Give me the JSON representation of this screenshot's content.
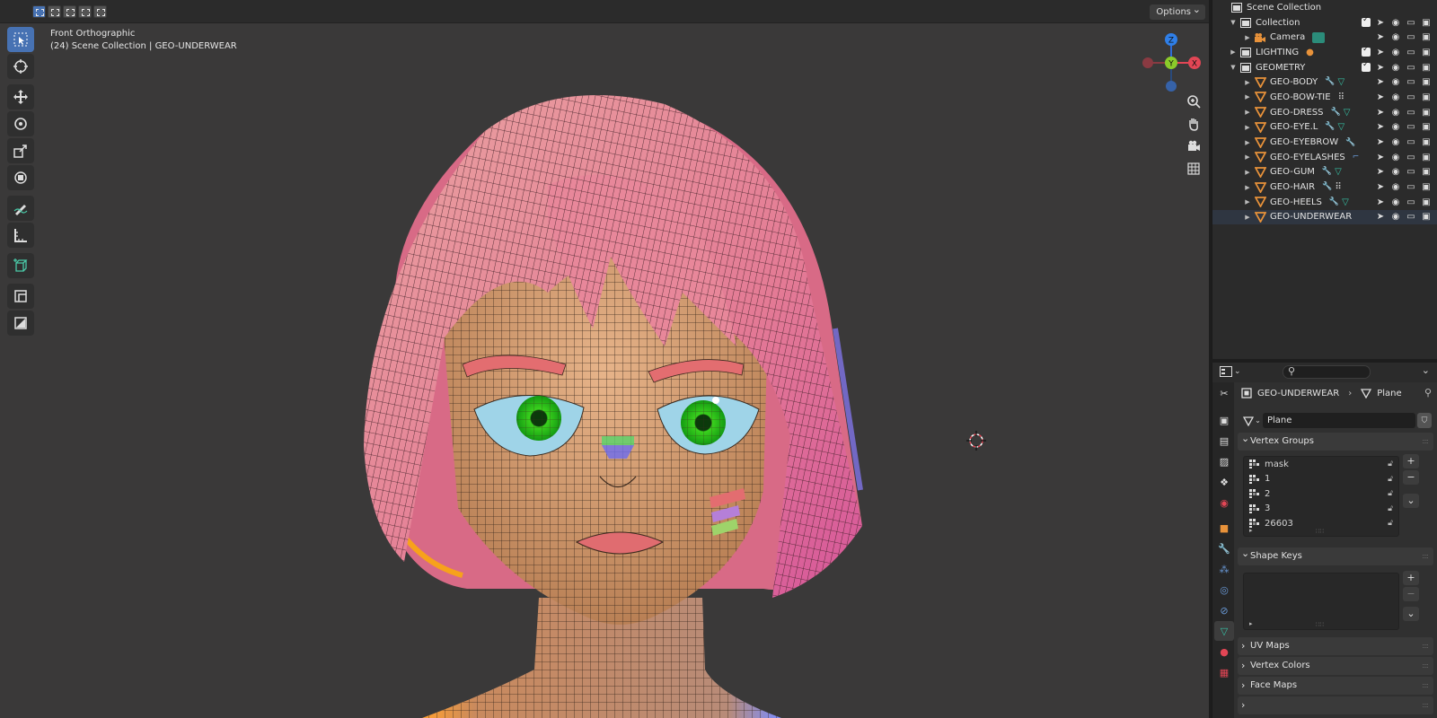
{
  "viewport": {
    "mode_label": "Front Orthographic",
    "context_label": "(24) Scene Collection | GEO-UNDERWEAR",
    "options_label": "Options",
    "gizmo": {
      "z": "Z",
      "y": "Y",
      "x": "X"
    }
  },
  "outliner": {
    "root": "Scene Collection",
    "rows": [
      {
        "name": "Collection",
        "depth": 1,
        "type": "collection",
        "checked": true
      },
      {
        "name": "Camera",
        "depth": 2,
        "type": "camera",
        "checked": false
      },
      {
        "name": "LIGHTING",
        "depth": 1,
        "type": "collection",
        "checked": true
      },
      {
        "name": "GEOMETRY",
        "depth": 1,
        "type": "collection",
        "checked": true
      },
      {
        "name": "GEO-BODY",
        "depth": 2,
        "type": "mesh"
      },
      {
        "name": "GEO-BOW-TIE",
        "depth": 2,
        "type": "mesh"
      },
      {
        "name": "GEO-DRESS",
        "depth": 2,
        "type": "mesh"
      },
      {
        "name": "GEO-EYE.L",
        "depth": 2,
        "type": "mesh"
      },
      {
        "name": "GEO-EYEBROW",
        "depth": 2,
        "type": "mesh"
      },
      {
        "name": "GEO-EYELASHES",
        "depth": 2,
        "type": "mesh"
      },
      {
        "name": "GEO-GUM",
        "depth": 2,
        "type": "mesh"
      },
      {
        "name": "GEO-HAIR",
        "depth": 2,
        "type": "mesh"
      },
      {
        "name": "GEO-HEELS",
        "depth": 2,
        "type": "mesh"
      },
      {
        "name": "GEO-UNDERWEAR",
        "depth": 2,
        "type": "mesh",
        "selected": true
      }
    ]
  },
  "properties": {
    "breadcrumb_object": "GEO-UNDERWEAR",
    "breadcrumb_data": "Plane",
    "data_name": "Plane",
    "vertex_groups_title": "Vertex Groups",
    "vertex_groups": [
      "mask",
      "1",
      "2",
      "3",
      "26603"
    ],
    "shape_keys_title": "Shape Keys",
    "uv_maps_title": "UV Maps",
    "vertex_colors_title": "Vertex Colors",
    "face_maps_title": "Face Maps"
  },
  "colors": {
    "accent": "#4772b3",
    "mesh_icon": "#e8923a",
    "modifier_icon": "#6a9ad8",
    "data_icon": "#36c1a5"
  }
}
